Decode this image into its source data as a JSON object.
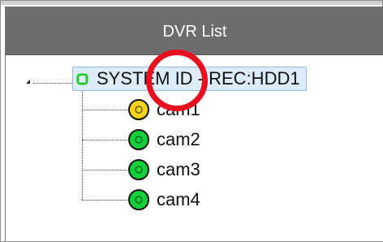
{
  "panel": {
    "title": "DVR List"
  },
  "tree": {
    "root": {
      "label": "SYSTEM ID - REC:HDD1",
      "status": "online",
      "icon": "system-status-icon",
      "color": "#1fcb22"
    },
    "cameras": [
      {
        "label": "cam1",
        "status": "warning",
        "icon": "camera-status-icon",
        "color": "#f4d51b"
      },
      {
        "label": "cam2",
        "status": "online",
        "icon": "camera-status-icon",
        "color": "#13d13b"
      },
      {
        "label": "cam3",
        "status": "online",
        "icon": "camera-status-icon",
        "color": "#13d13b"
      },
      {
        "label": "cam4",
        "status": "online",
        "icon": "camera-status-icon",
        "color": "#13d13b"
      }
    ]
  },
  "annotation": {
    "shape": "circle",
    "color": "#e8101f"
  }
}
